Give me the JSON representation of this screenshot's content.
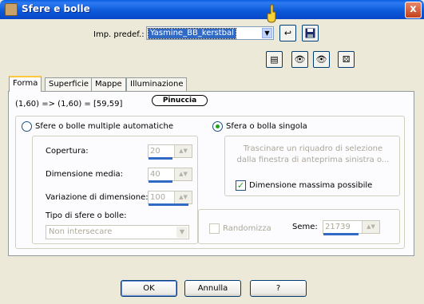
{
  "window": {
    "title": "Sfere e bolle",
    "close_glyph": "x"
  },
  "preset": {
    "label": "Imp. predef.:",
    "value": "Yasmine_BB_kerstbal",
    "icons": [
      "undo-icon",
      "save-icon",
      "list-icon",
      "eye-lock-icon",
      "eye-icon",
      "dice-icon"
    ]
  },
  "tabs": [
    {
      "label": "Forma",
      "active": true
    },
    {
      "label": "Superficie",
      "active": false
    },
    {
      "label": "Mappe",
      "active": false
    },
    {
      "label": "Illuminazione",
      "active": false
    }
  ],
  "coords_text": "(1,60) => (1,60) = [59,59]",
  "watermark": "Pinuccia",
  "auto": {
    "radio_label": "Sfere o bolle multiple automatiche",
    "selected": false,
    "coverage_label": "Copertura:",
    "coverage_value": "20",
    "avg_size_label": "Dimensione media:",
    "avg_size_value": "40",
    "size_var_label": "Variazione di dimensione:",
    "size_var_value": "100",
    "type_label": "Tipo di sfere o bolle:",
    "type_value": "Non intersecare",
    "randomize_label": "Randomizza",
    "randomize_checked": false,
    "seed_label": "Seme:",
    "seed_value": "21739"
  },
  "single": {
    "radio_label": "Sfera o bolla singola",
    "selected": true,
    "hint": "Trascinare un riquadro di selezione dalla finestra di anteprima sinistra o...",
    "max_size_label": "Dimensione massima possibile",
    "max_size_checked": true
  },
  "buttons": {
    "ok": "OK",
    "cancel": "Annulla",
    "help": "?"
  }
}
